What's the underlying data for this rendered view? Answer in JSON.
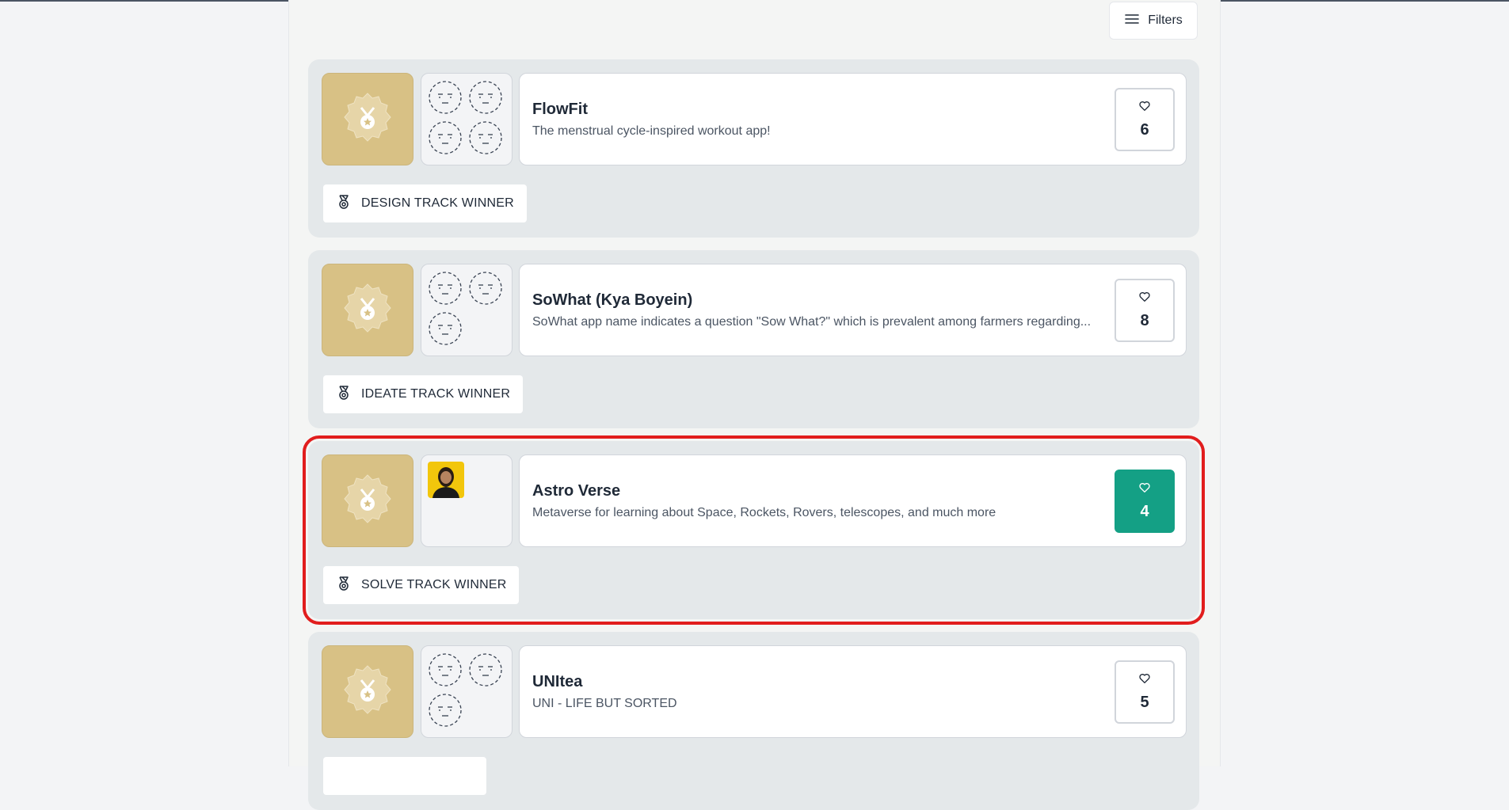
{
  "toolbar": {
    "filters_label": "Filters",
    "filters_icon": "menu-lines-icon"
  },
  "projects": [
    {
      "title": "FlowFit",
      "description": "The menstrual cycle-inspired workout app!",
      "likes": "6",
      "liked": false,
      "badge": "DESIGN TRACK WINNER",
      "members": 4
    },
    {
      "title": "SoWhat (Kya Boyein)",
      "description": "SoWhat app name indicates a question \"Sow What?\" which is prevalent among farmers regarding...",
      "likes": "8",
      "liked": false,
      "badge": "IDEATE TRACK WINNER",
      "members": 3
    },
    {
      "title": "Astro Verse",
      "description": "Metaverse for learning about Space, Rockets, Rovers, telescopes, and much more",
      "likes": "4",
      "liked": true,
      "badge": "SOLVE TRACK WINNER",
      "members": 1,
      "highlighted": true
    },
    {
      "title": "UNItea",
      "description": "UNI - LIFE BUT SORTED",
      "likes": "5",
      "liked": false,
      "badge": "",
      "members": 3
    }
  ],
  "colors": {
    "medal_tile": "#d8c185",
    "liked_button": "#14a085",
    "highlight_outline": "#e11d1d"
  }
}
